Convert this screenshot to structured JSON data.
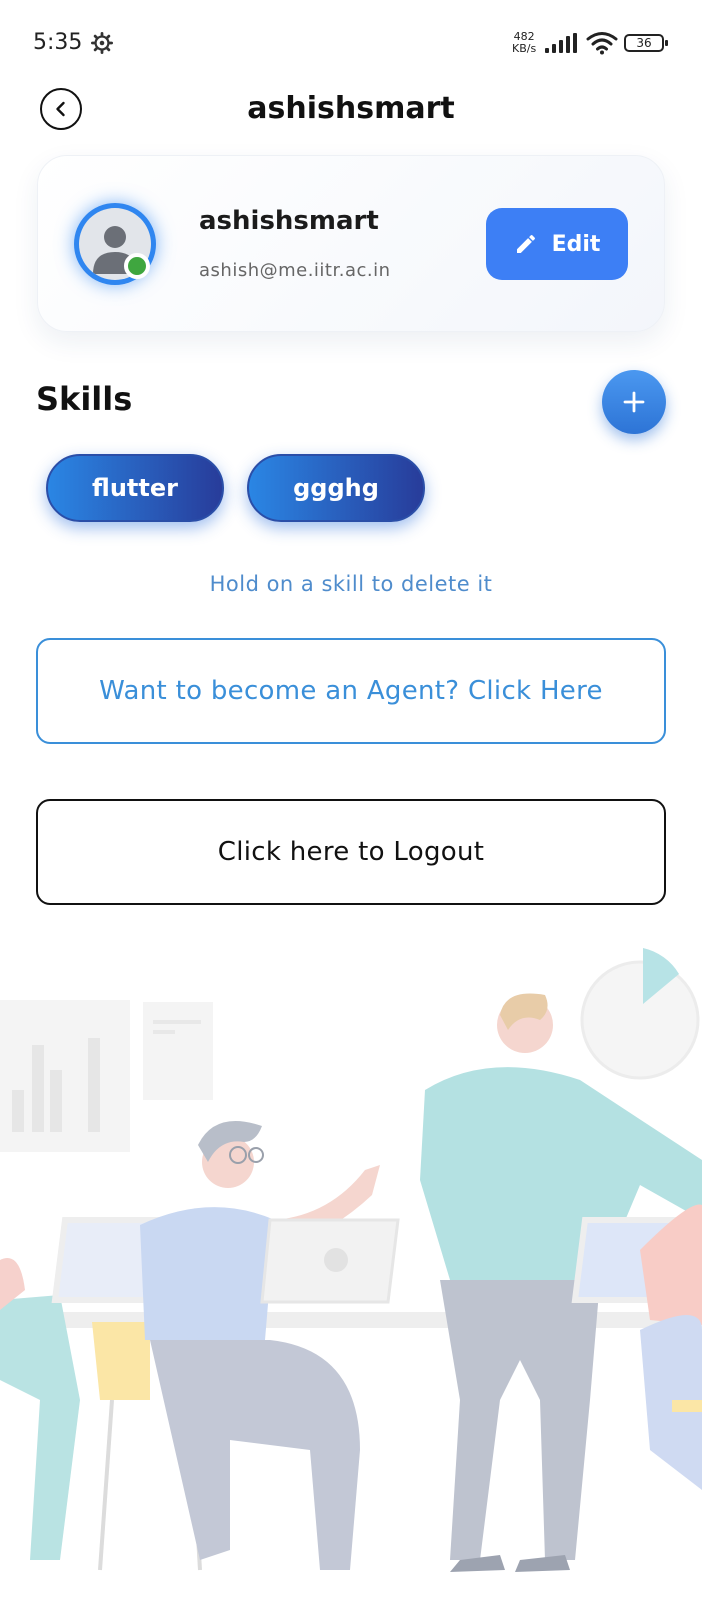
{
  "status_bar": {
    "time": "5:35",
    "net_speed_value": "482",
    "net_speed_unit": "KB/s",
    "battery": "36"
  },
  "header": {
    "title": "ashishsmart"
  },
  "profile": {
    "name": "ashishsmart",
    "email": "ashish@me.iitr.ac.in",
    "edit_label": "Edit"
  },
  "skills": {
    "title": "Skills",
    "items": [
      {
        "label": "flutter"
      },
      {
        "label": "ggghg"
      }
    ],
    "hint": "Hold on a skill to delete it"
  },
  "actions": {
    "agent_label": "Want to become an Agent? Click Here",
    "logout_label": "Click here to Logout"
  },
  "colors": {
    "accent": "#3d7ff5",
    "chip_start": "#2a86e4",
    "chip_end": "#283c9a",
    "online": "#3fa63f",
    "agent_outline": "#3a8fd9"
  },
  "icons": {
    "back": "back-arrow-icon",
    "edit": "pencil-icon",
    "add": "plus-icon",
    "settings": "gear-icon",
    "signal": "signal-icon",
    "wifi": "wifi-icon",
    "battery": "battery-icon"
  }
}
